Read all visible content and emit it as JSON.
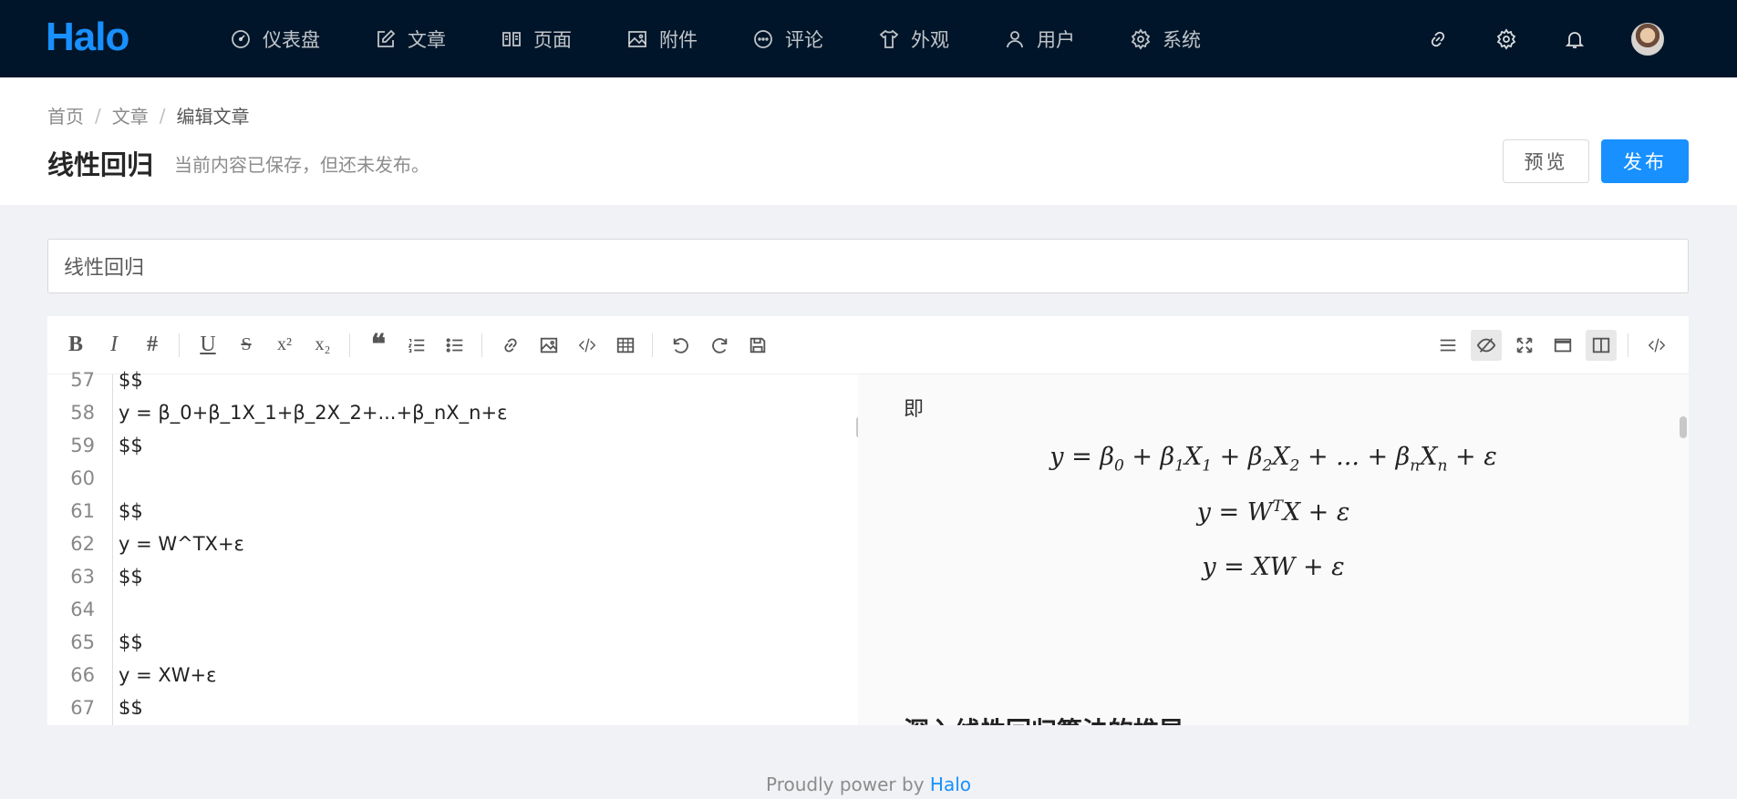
{
  "app": {
    "logo": "Halo"
  },
  "nav": [
    {
      "label": "仪表盘",
      "icon": "dashboard-icon"
    },
    {
      "label": "文章",
      "icon": "edit-icon"
    },
    {
      "label": "页面",
      "icon": "book-icon"
    },
    {
      "label": "附件",
      "icon": "picture-icon"
    },
    {
      "label": "评论",
      "icon": "comment-icon"
    },
    {
      "label": "外观",
      "icon": "shirt-icon"
    },
    {
      "label": "用户",
      "icon": "user-icon"
    },
    {
      "label": "系统",
      "icon": "gear-icon"
    }
  ],
  "topbar_right": [
    "link-icon",
    "settings-icon",
    "bell-icon",
    "avatar"
  ],
  "breadcrumb": [
    "首页",
    "文章",
    "编辑文章"
  ],
  "page": {
    "title": "线性回归",
    "status": "当前内容已保存，但还未发布。",
    "preview_label": "预览",
    "publish_label": "发布"
  },
  "post_title_value": "线性回归",
  "toolbar": {
    "left": [
      "bold-icon",
      "italic-icon",
      "heading-icon",
      "underline-icon",
      "strikethrough-icon",
      "superscript-icon",
      "subscript-icon",
      "quote-icon",
      "ordered-list-icon",
      "unordered-list-icon",
      "link-icon",
      "image-icon",
      "code-icon",
      "table-icon",
      "undo-icon",
      "redo-icon",
      "save-icon"
    ],
    "right": [
      "navigation-icon",
      "preview-toggle-icon",
      "fullscreen-icon",
      "window-icon",
      "split-view-icon",
      "html-code-icon"
    ]
  },
  "code_lines": [
    {
      "n": "57",
      "text": "$$"
    },
    {
      "n": "58",
      "text": "y = β_0+β_1X_1+β_2X_2+...+β_nX_n+ε"
    },
    {
      "n": "59",
      "text": "$$"
    },
    {
      "n": "60",
      "text": ""
    },
    {
      "n": "61",
      "text": "$$"
    },
    {
      "n": "62",
      "text": "y = W^TX+ε"
    },
    {
      "n": "63",
      "text": "$$"
    },
    {
      "n": "64",
      "text": ""
    },
    {
      "n": "65",
      "text": "$$"
    },
    {
      "n": "66",
      "text": "y = XW+ε"
    },
    {
      "n": "67",
      "text": "$$"
    }
  ],
  "preview": {
    "text": "即",
    "heading": "深入线性回归算法的推导"
  },
  "footer": {
    "prefix": "Proudly power by ",
    "link": "Halo"
  },
  "colors": {
    "nav_bg": "#001529",
    "primary": "#1890ff"
  }
}
